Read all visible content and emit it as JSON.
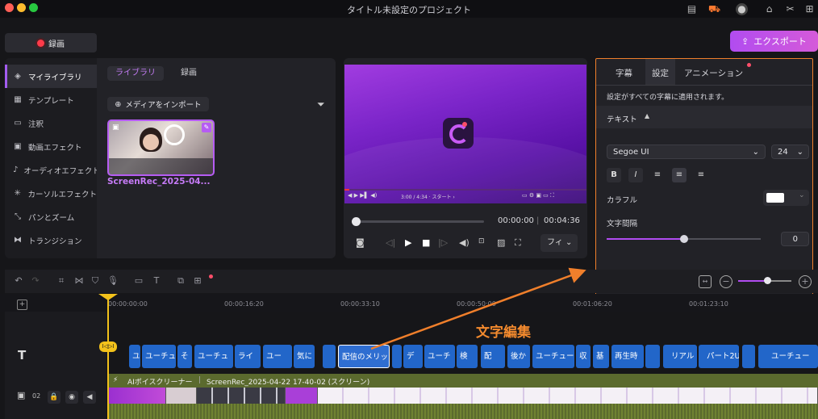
{
  "window": {
    "title": "タイトル未設定のプロジェクト"
  },
  "top_actions": {
    "record_label": "録画",
    "export_label": "エクスポート"
  },
  "sidebar": {
    "items": [
      {
        "label": "マイライブラリ",
        "icon": "layers-icon"
      },
      {
        "label": "テンプレート",
        "icon": "template-icon"
      },
      {
        "label": "注釈",
        "icon": "annotation-icon"
      },
      {
        "label": "動画エフェクト",
        "icon": "video-effect-icon"
      },
      {
        "label": "オーディオエフェクト",
        "icon": "audio-effect-icon"
      },
      {
        "label": "カーソルエフェクト",
        "icon": "cursor-effect-icon"
      },
      {
        "label": "パンとズーム",
        "icon": "pan-zoom-icon"
      },
      {
        "label": "トランジション",
        "icon": "transition-icon"
      }
    ]
  },
  "library": {
    "tabs": [
      "ライブラリ",
      "録画"
    ],
    "import_label": "メディアをインポート",
    "media_name": "ScreenRec_2025-04..."
  },
  "preview": {
    "current_time": "00:00:00",
    "separator": "|",
    "total_time": "00:04:36",
    "fit_label": "フィ",
    "video_caption": "3:00 / 4:34 · スタート ›",
    "playback_progress": 0.0
  },
  "settings": {
    "tabs": [
      "字幕",
      "設定",
      "アニメーション"
    ],
    "note": "設定がすべての字幕に適用されます。",
    "section": "テキスト",
    "font": "Segoe UI",
    "font_size": "24",
    "color_label": "カラフル",
    "spacing_label": "文字間隔",
    "spacing_value": "0"
  },
  "timeline": {
    "ticks": [
      "00:00:00:00",
      "00:00:16:20",
      "00:00:33:10",
      "00:00:50:00",
      "00:01:06:20",
      "00:01:23:10"
    ],
    "track_number": "02",
    "marker_label": "文字編集",
    "playhead_label": "I◁▷I",
    "clips": [
      "ユーチュ",
      "そ",
      "ユーチュ",
      "ライ",
      "ユー",
      "気に",
      "",
      "配信のメリッ",
      "デ",
      "ユーチ",
      "検",
      "配",
      "後か",
      "ユーチュー",
      "収",
      "基",
      "再生時",
      "",
      "リアル",
      "パート2U",
      "",
      "ユーチュー"
    ],
    "video_track_label": "AIボイスクリーナー",
    "video_track_file": "ScreenRec_2025-04-22 17-40-02 (スクリーン)"
  },
  "colors": {
    "accent": "#b14cf0",
    "highlight_box": "#f07f2b",
    "clip_blue": "#2266c9",
    "playhead": "#f3c21b"
  }
}
